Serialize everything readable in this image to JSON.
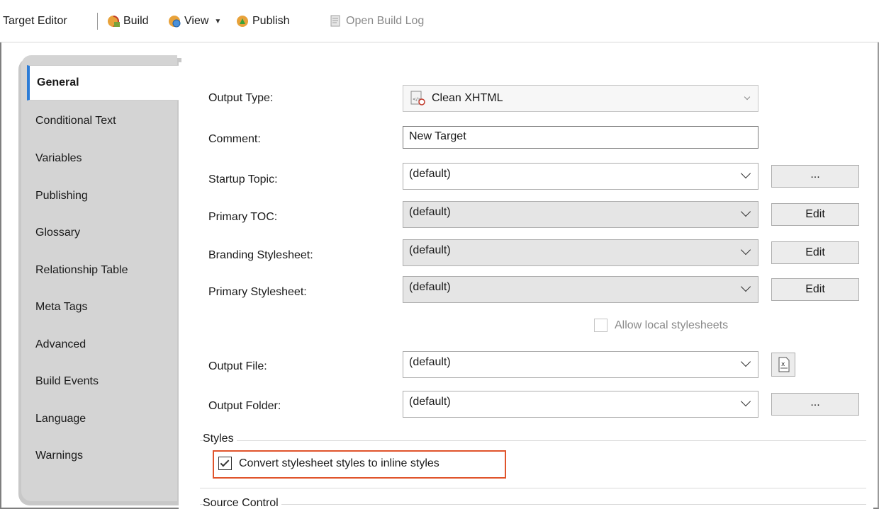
{
  "toolbar": {
    "title": "Target Editor",
    "build": "Build",
    "view": "View",
    "publish": "Publish",
    "open_build_log": "Open Build Log"
  },
  "tabs": [
    {
      "label": "General",
      "active": true
    },
    {
      "label": "Conditional Text"
    },
    {
      "label": "Variables"
    },
    {
      "label": "Publishing"
    },
    {
      "label": "Glossary"
    },
    {
      "label": "Relationship Table"
    },
    {
      "label": "Meta Tags"
    },
    {
      "label": "Advanced"
    },
    {
      "label": "Build Events"
    },
    {
      "label": "Language"
    },
    {
      "label": "Warnings"
    }
  ],
  "form": {
    "output_type_label": "Output Type:",
    "output_type_value": "Clean XHTML",
    "comment_label": "Comment:",
    "comment_value": "New Target",
    "startup_topic_label": "Startup Topic:",
    "startup_topic_value": "(default)",
    "startup_topic_button": "...",
    "primary_toc_label": "Primary TOC:",
    "primary_toc_value": "(default)",
    "primary_toc_button": "Edit",
    "branding_label": "Branding Stylesheet:",
    "branding_value": "(default)",
    "branding_button": "Edit",
    "primary_stylesheet_label": "Primary Stylesheet:",
    "primary_stylesheet_value": "(default)",
    "primary_stylesheet_button": "Edit",
    "allow_local_label": "Allow local stylesheets",
    "allow_local_checked": false,
    "output_file_label": "Output File:",
    "output_file_value": "(default)",
    "output_folder_label": "Output Folder:",
    "output_folder_value": "(default)",
    "output_folder_button": "...",
    "styles_group": "Styles",
    "convert_label": "Convert stylesheet styles to inline styles",
    "convert_checked": true,
    "source_control_group": "Source Control"
  },
  "colors": {
    "accent": "#2c7cd6",
    "highlight": "#e0542b",
    "sidebar": "#d4d4d4"
  }
}
